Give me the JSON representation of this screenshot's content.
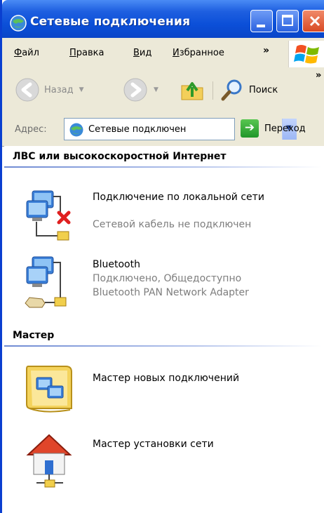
{
  "window": {
    "title": "Сетевые подключения"
  },
  "menu": {
    "items": [
      {
        "label": "Файл",
        "accel": "Ф",
        "rest": "айл"
      },
      {
        "label": "Правка",
        "accel": "П",
        "rest": "равка"
      },
      {
        "label": "Вид",
        "accel": "В",
        "rest": "ид"
      },
      {
        "label": "Избранное",
        "accel": "И",
        "rest": "збранное"
      }
    ],
    "overflow": "»"
  },
  "toolbar": {
    "back_label": "Назад",
    "search_label": "Поиск",
    "overflow": "»"
  },
  "address": {
    "label": "Адрес:",
    "value": "Сетевые подключен",
    "go_label": "Переход"
  },
  "groups": [
    {
      "header": "ЛВС или высокоскоростной Интернет",
      "items": [
        {
          "title": "Подключение по локальной сети",
          "status": "Сетевой кабель не подключен",
          "device": "",
          "icon": "lan-disconnected-icon"
        },
        {
          "title": "Bluetooth",
          "status": "Подключено, Общедоступно",
          "device": "Bluetooth PAN Network Adapter",
          "icon": "bluetooth-network-icon"
        }
      ]
    },
    {
      "header": "Мастер",
      "items": [
        {
          "title": "Мастер новых подключений",
          "icon": "new-connection-wizard-icon"
        },
        {
          "title": "Мастер установки сети",
          "icon": "network-setup-wizard-icon"
        }
      ]
    }
  ],
  "colors": {
    "titlebar": "#0b4fd8",
    "chrome": "#ece9d8",
    "disconnect_x": "#e02020",
    "secondary_text": "#7e7e7e"
  }
}
